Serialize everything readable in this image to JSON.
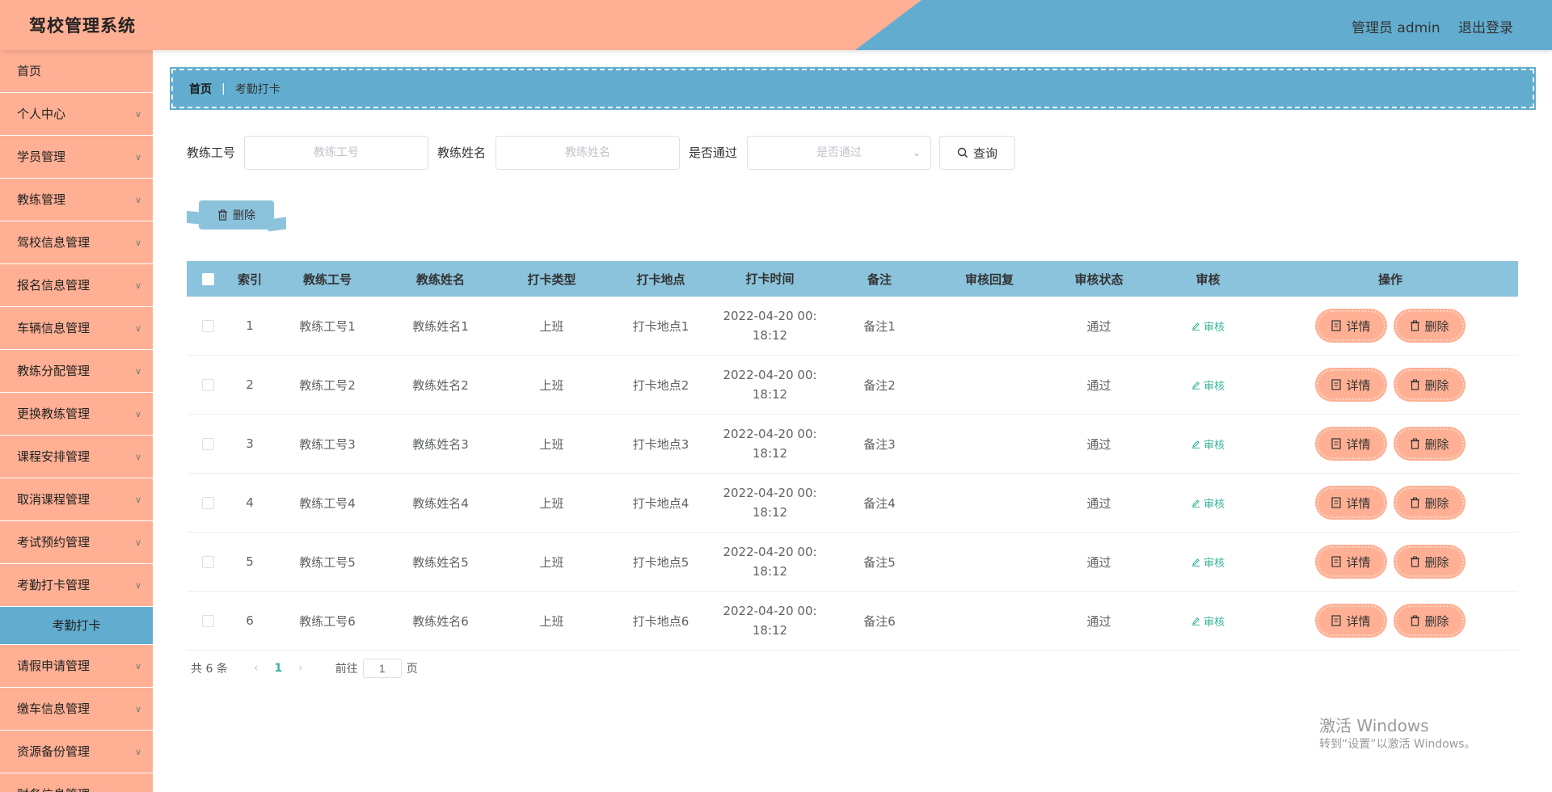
{
  "header": {
    "app_title": "驾校管理系统",
    "user_label": "管理员 admin",
    "logout_label": "退出登录",
    "colors": {
      "peach": "#ffb094",
      "blue": "#62adcf"
    }
  },
  "sidebar": {
    "items": [
      {
        "label": "首页"
      },
      {
        "label": "个人中心"
      },
      {
        "label": "学员管理"
      },
      {
        "label": "教练管理"
      },
      {
        "label": "驾校信息管理"
      },
      {
        "label": "报名信息管理"
      },
      {
        "label": "车辆信息管理"
      },
      {
        "label": "教练分配管理"
      },
      {
        "label": "更换教练管理"
      },
      {
        "label": "课程安排管理"
      },
      {
        "label": "取消课程管理"
      },
      {
        "label": "考试预约管理"
      },
      {
        "label": "考勤打卡管理"
      }
    ],
    "active_sub": "考勤打卡",
    "items_after": [
      {
        "label": "请假申请管理"
      },
      {
        "label": "缴车信息管理"
      },
      {
        "label": "资源备份管理"
      },
      {
        "label": "财务信息管理"
      }
    ]
  },
  "breadcrumb": {
    "home": "首页",
    "separator": "|",
    "current": "考勤打卡"
  },
  "search": {
    "coach_no_label": "教练工号",
    "coach_no_placeholder": "教练工号",
    "coach_name_label": "教练姓名",
    "coach_name_placeholder": "教练姓名",
    "passed_label": "是否通过",
    "passed_placeholder": "是否通过",
    "query_label": "查询"
  },
  "toolbar": {
    "delete_label": "删除"
  },
  "table": {
    "headers": [
      "索引",
      "教练工号",
      "教练姓名",
      "打卡类型",
      "打卡地点",
      "打卡时间",
      "备注",
      "审核回复",
      "审核状态",
      "审核",
      "操作"
    ],
    "audit_label": "审核",
    "detail_label": "详情",
    "delete_label": "删除",
    "rows": [
      {
        "index": "1",
        "coach_no": "教练工号1",
        "coach_name": "教练姓名1",
        "type": "上班",
        "place": "打卡地点1",
        "time_date": "2022-04-20 00:",
        "time_clock": "18:12",
        "remark": "备注1",
        "reply": "",
        "status": "通过"
      },
      {
        "index": "2",
        "coach_no": "教练工号2",
        "coach_name": "教练姓名2",
        "type": "上班",
        "place": "打卡地点2",
        "time_date": "2022-04-20 00:",
        "time_clock": "18:12",
        "remark": "备注2",
        "reply": "",
        "status": "通过"
      },
      {
        "index": "3",
        "coach_no": "教练工号3",
        "coach_name": "教练姓名3",
        "type": "上班",
        "place": "打卡地点3",
        "time_date": "2022-04-20 00:",
        "time_clock": "18:12",
        "remark": "备注3",
        "reply": "",
        "status": "通过"
      },
      {
        "index": "4",
        "coach_no": "教练工号4",
        "coach_name": "教练姓名4",
        "type": "上班",
        "place": "打卡地点4",
        "time_date": "2022-04-20 00:",
        "time_clock": "18:12",
        "remark": "备注4",
        "reply": "",
        "status": "通过"
      },
      {
        "index": "5",
        "coach_no": "教练工号5",
        "coach_name": "教练姓名5",
        "type": "上班",
        "place": "打卡地点5",
        "time_date": "2022-04-20 00:",
        "time_clock": "18:12",
        "remark": "备注5",
        "reply": "",
        "status": "通过"
      },
      {
        "index": "6",
        "coach_no": "教练工号6",
        "coach_name": "教练姓名6",
        "type": "上班",
        "place": "打卡地点6",
        "time_date": "2022-04-20 00:",
        "time_clock": "18:12",
        "remark": "备注6",
        "reply": "",
        "status": "通过"
      }
    ]
  },
  "pagination": {
    "total_label": "共 6 条",
    "prev_icon": "chevron-left-icon",
    "current_page": "1",
    "next_icon": "chevron-right-icon",
    "goto_label": "前往",
    "goto_value": "1",
    "page_suffix": "页"
  },
  "watermark": {
    "title": "激活 Windows",
    "subtitle": "转到“设置”以激活 Windows。"
  }
}
